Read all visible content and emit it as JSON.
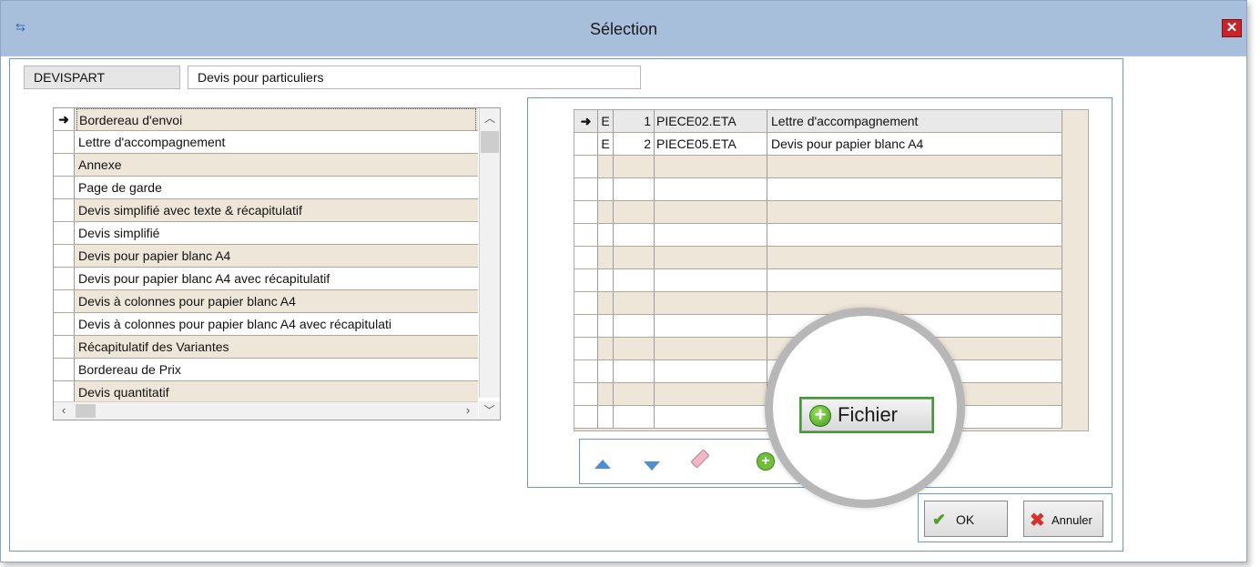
{
  "window": {
    "title": "Sélection",
    "close_label": "✕"
  },
  "header": {
    "code": "DEVISPART",
    "description": "Devis pour particuliers"
  },
  "left_list": {
    "items": [
      "Bordereau d'envoi",
      "Lettre d'accompagnement",
      "Annexe",
      "Page de garde",
      "Devis simplifié avec texte & récapitulatif",
      "Devis simplifié",
      "Devis pour papier blanc A4",
      "Devis pour papier blanc A4 avec récapitulatif",
      "Devis à colonnes pour papier blanc A4",
      "Devis à colonnes pour papier blanc A4 avec récapitulati",
      "Récapitulatif des Variantes",
      "Bordereau de Prix",
      "Devis quantitatif"
    ],
    "current_marker": "➜"
  },
  "selected_grid": {
    "current_marker": "➜",
    "rows": [
      {
        "type": "E",
        "num": "1",
        "file": "PIECE02.ETA",
        "label": "Lettre d'accompagnement"
      },
      {
        "type": "E",
        "num": "2",
        "file": "PIECE05.ETA",
        "label": "Devis pour papier blanc A4"
      }
    ]
  },
  "toolbar": {
    "add_file_label": "Fichier",
    "add_small": "+"
  },
  "actions": {
    "ok_label": "OK",
    "cancel_label": "Annuler"
  }
}
